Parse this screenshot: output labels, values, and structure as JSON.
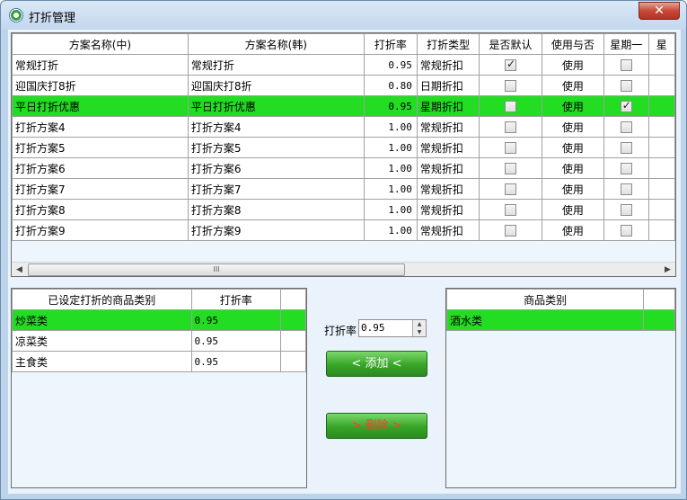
{
  "window": {
    "title": "打折管理",
    "close": "✕"
  },
  "plans": {
    "columns": [
      "方案名称(中)",
      "方案名称(韩)",
      "打折率",
      "打折类型",
      "是否默认",
      "使用与否",
      "星期一",
      "星"
    ],
    "rows": [
      {
        "zh": "常规打折",
        "ko": "常规打折",
        "rate": "0.95",
        "type": "常规折扣",
        "default": true,
        "use": "使用",
        "mon": false,
        "selected": false
      },
      {
        "zh": "迎国庆打8折",
        "ko": "迎国庆打8折",
        "rate": "0.80",
        "type": "日期折扣",
        "default": false,
        "use": "使用",
        "mon": false,
        "selected": false
      },
      {
        "zh": "平日打折优惠",
        "ko": "平日打折优惠",
        "rate": "0.95",
        "type": "星期折扣",
        "default": false,
        "use": "使用",
        "mon": true,
        "selected": true
      },
      {
        "zh": "打折方案4",
        "ko": "打折方案4",
        "rate": "1.00",
        "type": "常规折扣",
        "default": false,
        "use": "使用",
        "mon": false,
        "selected": false
      },
      {
        "zh": "打折方案5",
        "ko": "打折方案5",
        "rate": "1.00",
        "type": "常规折扣",
        "default": false,
        "use": "使用",
        "mon": false,
        "selected": false
      },
      {
        "zh": "打折方案6",
        "ko": "打折方案6",
        "rate": "1.00",
        "type": "常规折扣",
        "default": false,
        "use": "使用",
        "mon": false,
        "selected": false
      },
      {
        "zh": "打折方案7",
        "ko": "打折方案7",
        "rate": "1.00",
        "type": "常规折扣",
        "default": false,
        "use": "使用",
        "mon": false,
        "selected": false
      },
      {
        "zh": "打折方案8",
        "ko": "打折方案8",
        "rate": "1.00",
        "type": "常规折扣",
        "default": false,
        "use": "使用",
        "mon": false,
        "selected": false
      },
      {
        "zh": "打折方案9",
        "ko": "打折方案9",
        "rate": "1.00",
        "type": "常规折扣",
        "default": false,
        "use": "使用",
        "mon": false,
        "selected": false
      }
    ],
    "scroll_thumb": "III",
    "scroll_left": "◀",
    "scroll_right": "▶"
  },
  "assigned": {
    "columns": [
      "已设定打折的商品类别",
      "打折率"
    ],
    "rows": [
      {
        "category": "炒菜类",
        "rate": "0.95",
        "selected": true
      },
      {
        "category": "凉菜类",
        "rate": "0.95",
        "selected": false
      },
      {
        "category": "主食类",
        "rate": "0.95",
        "selected": false
      }
    ]
  },
  "available": {
    "columns": [
      "商品类别"
    ],
    "rows": [
      {
        "category": "酒水类",
        "selected": true
      }
    ]
  },
  "controls": {
    "rate_label": "打折率",
    "rate_value": "0.95",
    "add_label": "< 添加 <",
    "delete_label": "> 删除 >"
  },
  "colors": {
    "selected_row": "#22dd22",
    "button_green": "#38a528",
    "delete_text": "#ff3b2a"
  }
}
